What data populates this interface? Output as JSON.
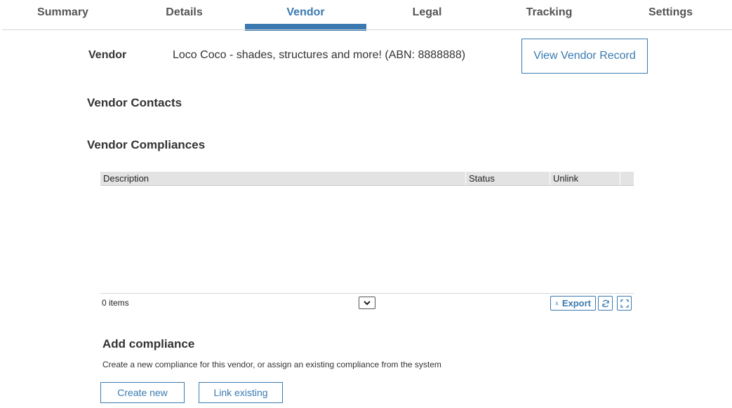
{
  "tabs": [
    {
      "label": "Summary"
    },
    {
      "label": "Details"
    },
    {
      "label": "Vendor",
      "active": true
    },
    {
      "label": "Legal"
    },
    {
      "label": "Tracking"
    },
    {
      "label": "Settings"
    }
  ],
  "vendor": {
    "label": "Vendor",
    "value": "Loco Coco - shades, structures and more! (ABN: 8888888)",
    "view_button": "View Vendor Record"
  },
  "sections": {
    "contacts_title": "Vendor Contacts",
    "compliances_title": "Vendor Compliances"
  },
  "grid": {
    "columns": [
      "Description",
      "Status",
      "Unlink"
    ],
    "rows": [],
    "items_label": "0 items",
    "export_label": "Export"
  },
  "add_compliance": {
    "title": "Add compliance",
    "description": "Create a new compliance for this vendor, or assign an existing compliance from the system",
    "create_button": "Create new",
    "link_button": "Link existing"
  },
  "colors": {
    "accent": "#3a7ab0",
    "header_bg": "#e3e3e3"
  },
  "icons": [
    "chevron-down-icon",
    "download-icon",
    "refresh-icon",
    "fullscreen-icon"
  ]
}
